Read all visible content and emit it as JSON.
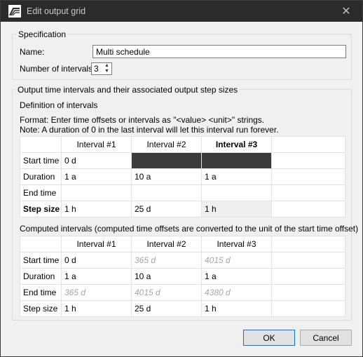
{
  "window": {
    "title": "Edit output grid",
    "close_glyph": "✕"
  },
  "specification": {
    "group_title": "Specification",
    "name_label": "Name:",
    "name_value": "Multi schedule",
    "intervals_label": "Number of intervals:",
    "intervals_value": "3"
  },
  "output": {
    "group_title": "Output time intervals and their associated output step sizes",
    "definition_title": "Definition of intervals",
    "format_note": "Format: Enter time offsets or intervals as \"<value> <unit>\" strings.",
    "duration_note": "Note: A duration of 0 in the last interval will let this interval run forever.",
    "definition_table": {
      "headers": [
        "Interval #1",
        "Interval #2",
        "Interval #3"
      ],
      "rows": [
        {
          "label": "Start time",
          "cells": [
            "0 d",
            "",
            ""
          ]
        },
        {
          "label": "Duration",
          "cells": [
            "1 a",
            "10 a",
            "1 a"
          ]
        },
        {
          "label": "End time",
          "cells": [
            "",
            "",
            ""
          ]
        },
        {
          "label": "Step size",
          "cells": [
            "1 h",
            "25 d",
            "1 h"
          ]
        }
      ]
    },
    "computed_title": "Computed intervals (computed time offsets are converted to the unit of the start time offset)",
    "computed_table": {
      "headers": [
        "Interval #1",
        "Interval #2",
        "Interval #3"
      ],
      "rows": [
        {
          "label": "Start time",
          "cells": [
            "0 d",
            "365 d",
            "4015 d"
          ]
        },
        {
          "label": "Duration",
          "cells": [
            "1 a",
            "10 a",
            "1 a"
          ]
        },
        {
          "label": "End time",
          "cells": [
            "365 d",
            "4015 d",
            "4380 d"
          ]
        },
        {
          "label": "Step size",
          "cells": [
            "1 h",
            "25 d",
            "1 h"
          ]
        }
      ]
    }
  },
  "buttons": {
    "ok": "OK",
    "cancel": "Cancel"
  }
}
